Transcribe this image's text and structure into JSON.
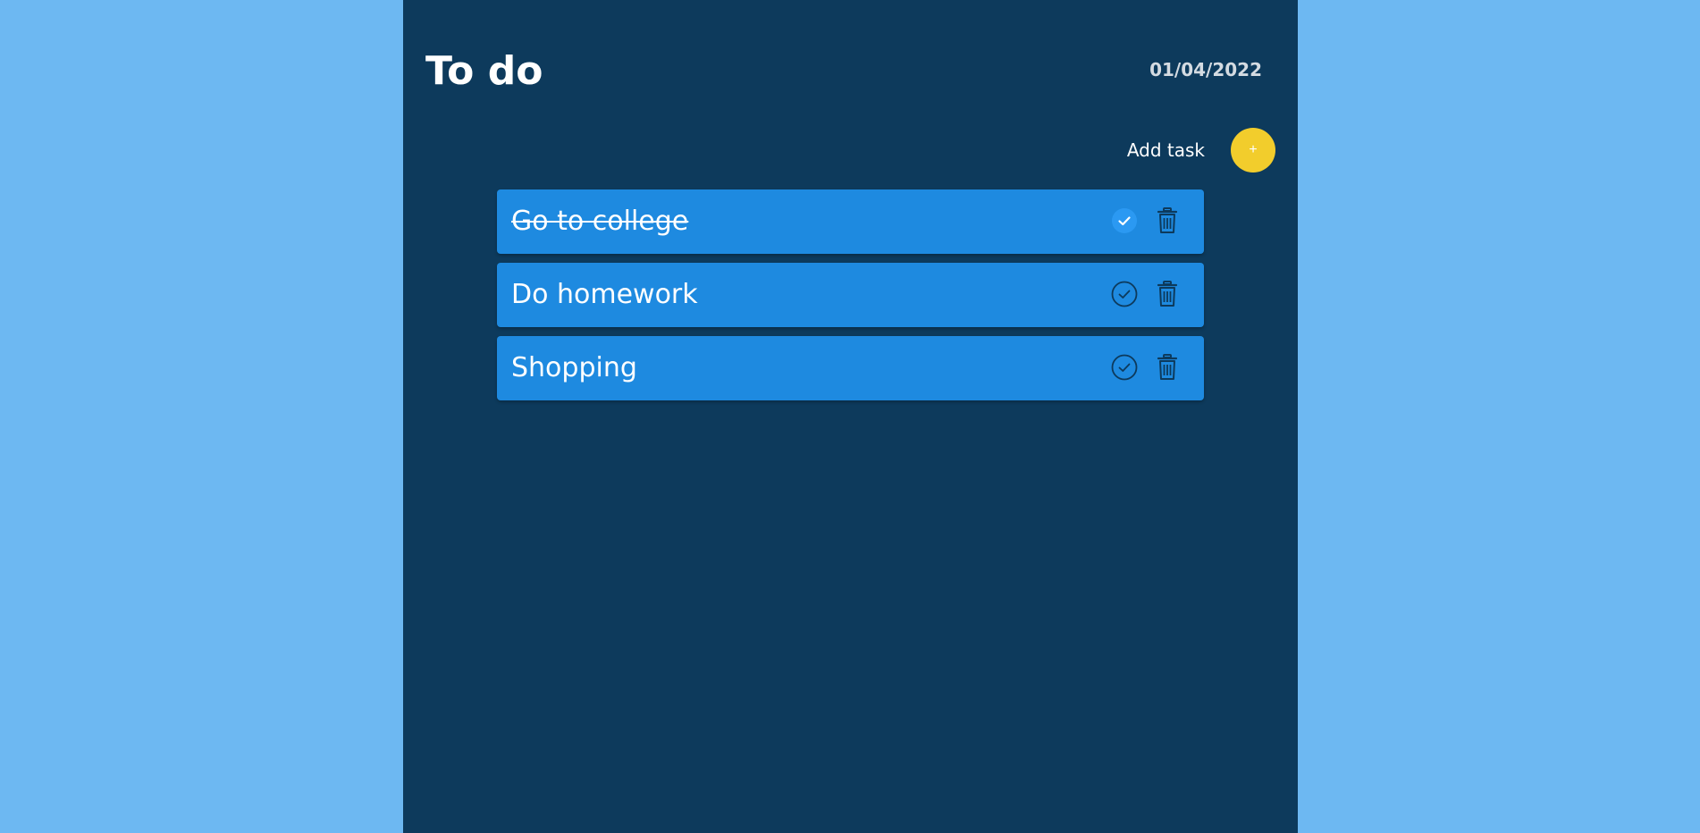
{
  "header": {
    "title": "To do",
    "date": "01/04/2022"
  },
  "add_task": {
    "label": "Add task",
    "button_symbol": "+",
    "button_color": "#f2cd2c"
  },
  "tasks": [
    {
      "text": "Go to college",
      "completed": true
    },
    {
      "text": "Do homework",
      "completed": false
    },
    {
      "text": "Shopping",
      "completed": false
    }
  ],
  "icons": {
    "complete": "check-circle-icon",
    "delete": "trash-icon"
  },
  "colors": {
    "page_background": "#6db8f2",
    "panel_background": "#0d3a5c",
    "task_background": "#1e8ae0",
    "icon_dark": "#0d3a5c",
    "completed_check_fill": "#2b99f2"
  }
}
